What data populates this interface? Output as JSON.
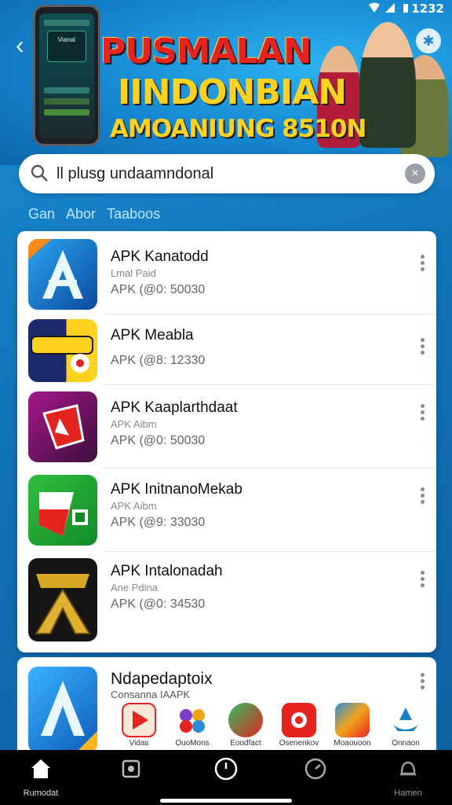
{
  "status_bar": {
    "time": "1232"
  },
  "banner": {
    "line1": "PUSMALAN",
    "line2": "IINDONBIAN",
    "line3": "AMOANIUNG 8510N",
    "phone_label": "Vianat"
  },
  "search": {
    "value": "ll plusg undaamndonal"
  },
  "tabs": [
    "Gan",
    "Abor",
    "Taaboos"
  ],
  "apps": [
    {
      "name": "APK Kanatodd",
      "sub": "Lmal Paid",
      "meta": "APK (@0: 50030",
      "icon": "apk-a-icon"
    },
    {
      "name": "APK Meabla",
      "sub": "",
      "meta": "APK (@8: 12330",
      "icon": "apk-burger-icon"
    },
    {
      "name": "APK Kaaplarthdaat",
      "sub": "APK Aibm",
      "meta": "APK (@0: 50030",
      "icon": "apk-red-shape-icon"
    },
    {
      "name": "APK InitnanoMekab",
      "sub": "APK Aibm",
      "meta": "APK (@9: 33030",
      "icon": "apk-green-flag-icon"
    },
    {
      "name": "APK Intalonadah",
      "sub": "Ane Pdina",
      "meta": "APK (@0: 34530",
      "icon": "apk-gold-icon"
    }
  ],
  "featured": {
    "name": "Ndapedaptoix",
    "sub": "Consanna IAAPK",
    "mini_apps": [
      {
        "label": "Vidas",
        "icon": "play-icon"
      },
      {
        "label": "OuoMons",
        "icon": "flower-icon"
      },
      {
        "label": "Eoodfact",
        "icon": "leaf-icon"
      },
      {
        "label": "Osenenkov",
        "icon": "tile-icon"
      },
      {
        "label": "Moaouoon",
        "icon": "cards-icon"
      },
      {
        "label": "Onnaon",
        "icon": "ship-icon"
      }
    ]
  },
  "nav": [
    {
      "label": "Rumodat",
      "icon": "home-icon"
    },
    {
      "label": "",
      "icon": "puzzle-icon"
    },
    {
      "label": "",
      "icon": "clock-icon"
    },
    {
      "label": "",
      "icon": "timer-icon"
    },
    {
      "label": "Hamen",
      "icon": "bell-icon"
    }
  ]
}
